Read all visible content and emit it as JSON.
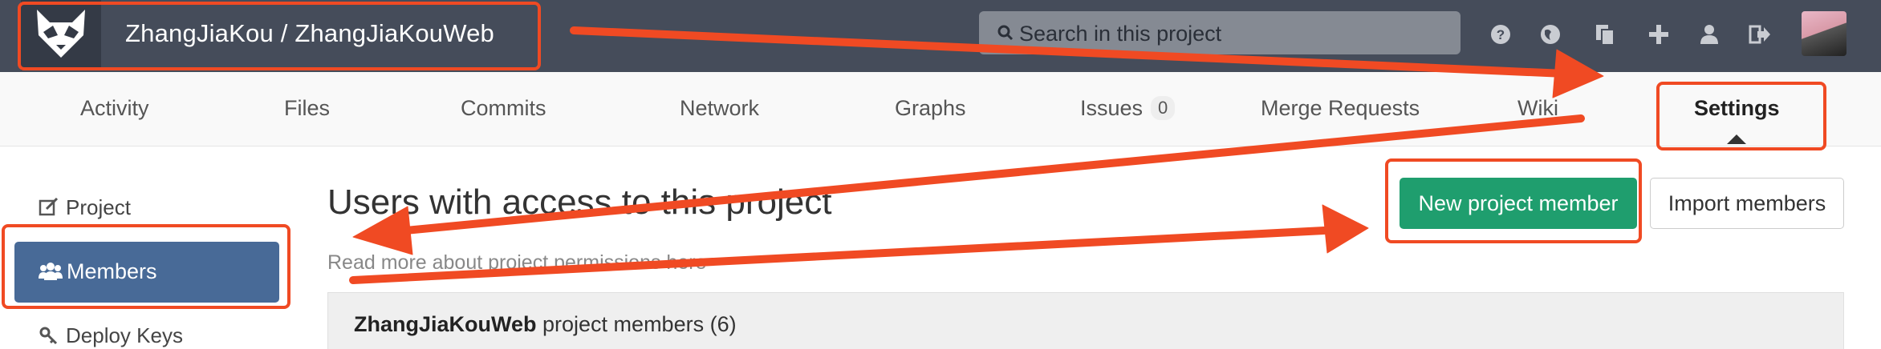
{
  "header": {
    "project_title": "ZhangJiaKou / ZhangJiaKouWeb",
    "search_placeholder": "Search in this project",
    "icons": [
      "help-icon",
      "globe-icon",
      "copy-icon",
      "plus-icon",
      "user-icon",
      "sign-out-icon"
    ]
  },
  "nav": {
    "tabs": [
      {
        "label": "Activity"
      },
      {
        "label": "Files"
      },
      {
        "label": "Commits"
      },
      {
        "label": "Network"
      },
      {
        "label": "Graphs"
      },
      {
        "label": "Issues",
        "badge": "0"
      },
      {
        "label": "Merge Requests"
      },
      {
        "label": "Wiki"
      },
      {
        "label": "Settings",
        "active": true
      }
    ]
  },
  "sidebar": {
    "items": [
      {
        "label": "Project",
        "icon": "edit-icon"
      },
      {
        "label": "Members",
        "icon": "users-icon",
        "active": true
      },
      {
        "label": "Deploy Keys",
        "icon": "key-icon"
      }
    ]
  },
  "main": {
    "title": "Users with access to this project",
    "subtitle": "Read more about project permissions here",
    "new_member_button": "New project member",
    "import_button": "Import members",
    "panel": {
      "project_name": "ZhangJiaKouWeb",
      "text": " project members (6)"
    }
  },
  "colors": {
    "header_bg": "#454c5a",
    "primary_green": "#1f9e6e",
    "sidebar_active": "#486a97",
    "annotation": "#f04a23"
  }
}
